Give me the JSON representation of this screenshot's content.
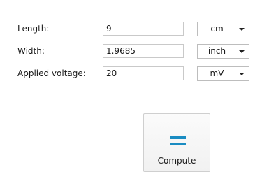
{
  "form": {
    "rows": [
      {
        "label": "Length:",
        "value": "9",
        "unit": "cm"
      },
      {
        "label": "Width:",
        "value": "1.9685",
        "unit": "inch"
      },
      {
        "label": "Applied voltage:",
        "value": "20",
        "unit": "mV"
      }
    ]
  },
  "compute": {
    "label": "Compute",
    "icon": "equals-icon",
    "icon_color": "#1a8cc2"
  }
}
